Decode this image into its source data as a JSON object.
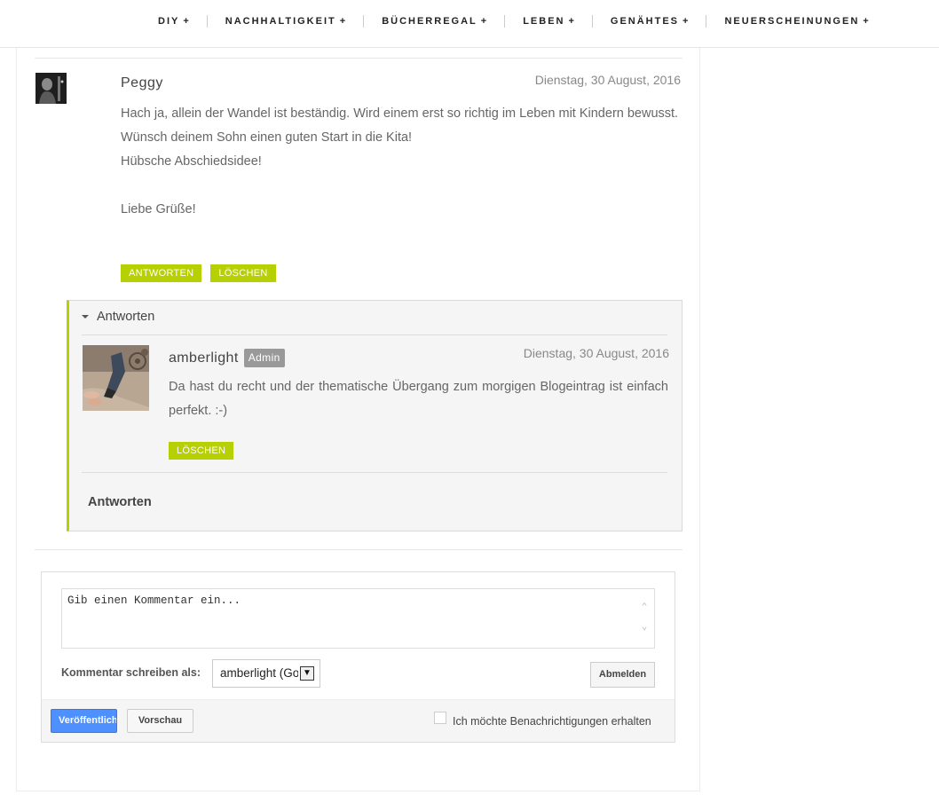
{
  "nav": {
    "items": [
      {
        "label": "DIY",
        "suffix": "+"
      },
      {
        "label": "NACHHALTIGKEIT",
        "suffix": "+"
      },
      {
        "label": "BÜCHERREGAL",
        "suffix": "+"
      },
      {
        "label": "LEBEN",
        "suffix": "+"
      },
      {
        "label": "GENÄHTES",
        "suffix": "+"
      },
      {
        "label": "NEUERSCHEINUNGEN",
        "suffix": "+"
      }
    ]
  },
  "comment": {
    "author": "Peggy",
    "date": "Dienstag, 30 August, 2016",
    "lines": [
      "Hach ja, allein der Wandel ist beständig. Wird einem erst so richtig im Leben mit Kindern bewusst.",
      "Wünsch deinem Sohn einen guten Start in die Kita!",
      "Hübsche Abschiedsidee!",
      "",
      "Liebe Grüße!"
    ],
    "reply_label": "ANTWORTEN",
    "delete_label": "LÖSCHEN"
  },
  "replies": {
    "toggle_label": "Antworten",
    "items": [
      {
        "author": "amberlight",
        "badge": "Admin",
        "date": "Dienstag, 30 August, 2016",
        "text": "Da hast du recht und der thematische Übergang zum morgigen Blogeintrag ist einfach perfekt. :-)",
        "delete_label": "LÖSCHEN"
      }
    ],
    "reply_link": "Antworten"
  },
  "form": {
    "placeholder": "Gib einen Kommentar ein...",
    "write_as_label": "Kommentar schreiben als:",
    "identity_value": "amberlight (Google)",
    "signout_label": "Abmelden",
    "publish_label": "Veröffentlichen",
    "preview_label": "Vorschau",
    "notify_label": "Ich möchte Benachrichtigungen erhalten",
    "notify_checked": false
  },
  "colors": {
    "accent": "#b7d003",
    "publish_blue": "#4d90fe"
  }
}
